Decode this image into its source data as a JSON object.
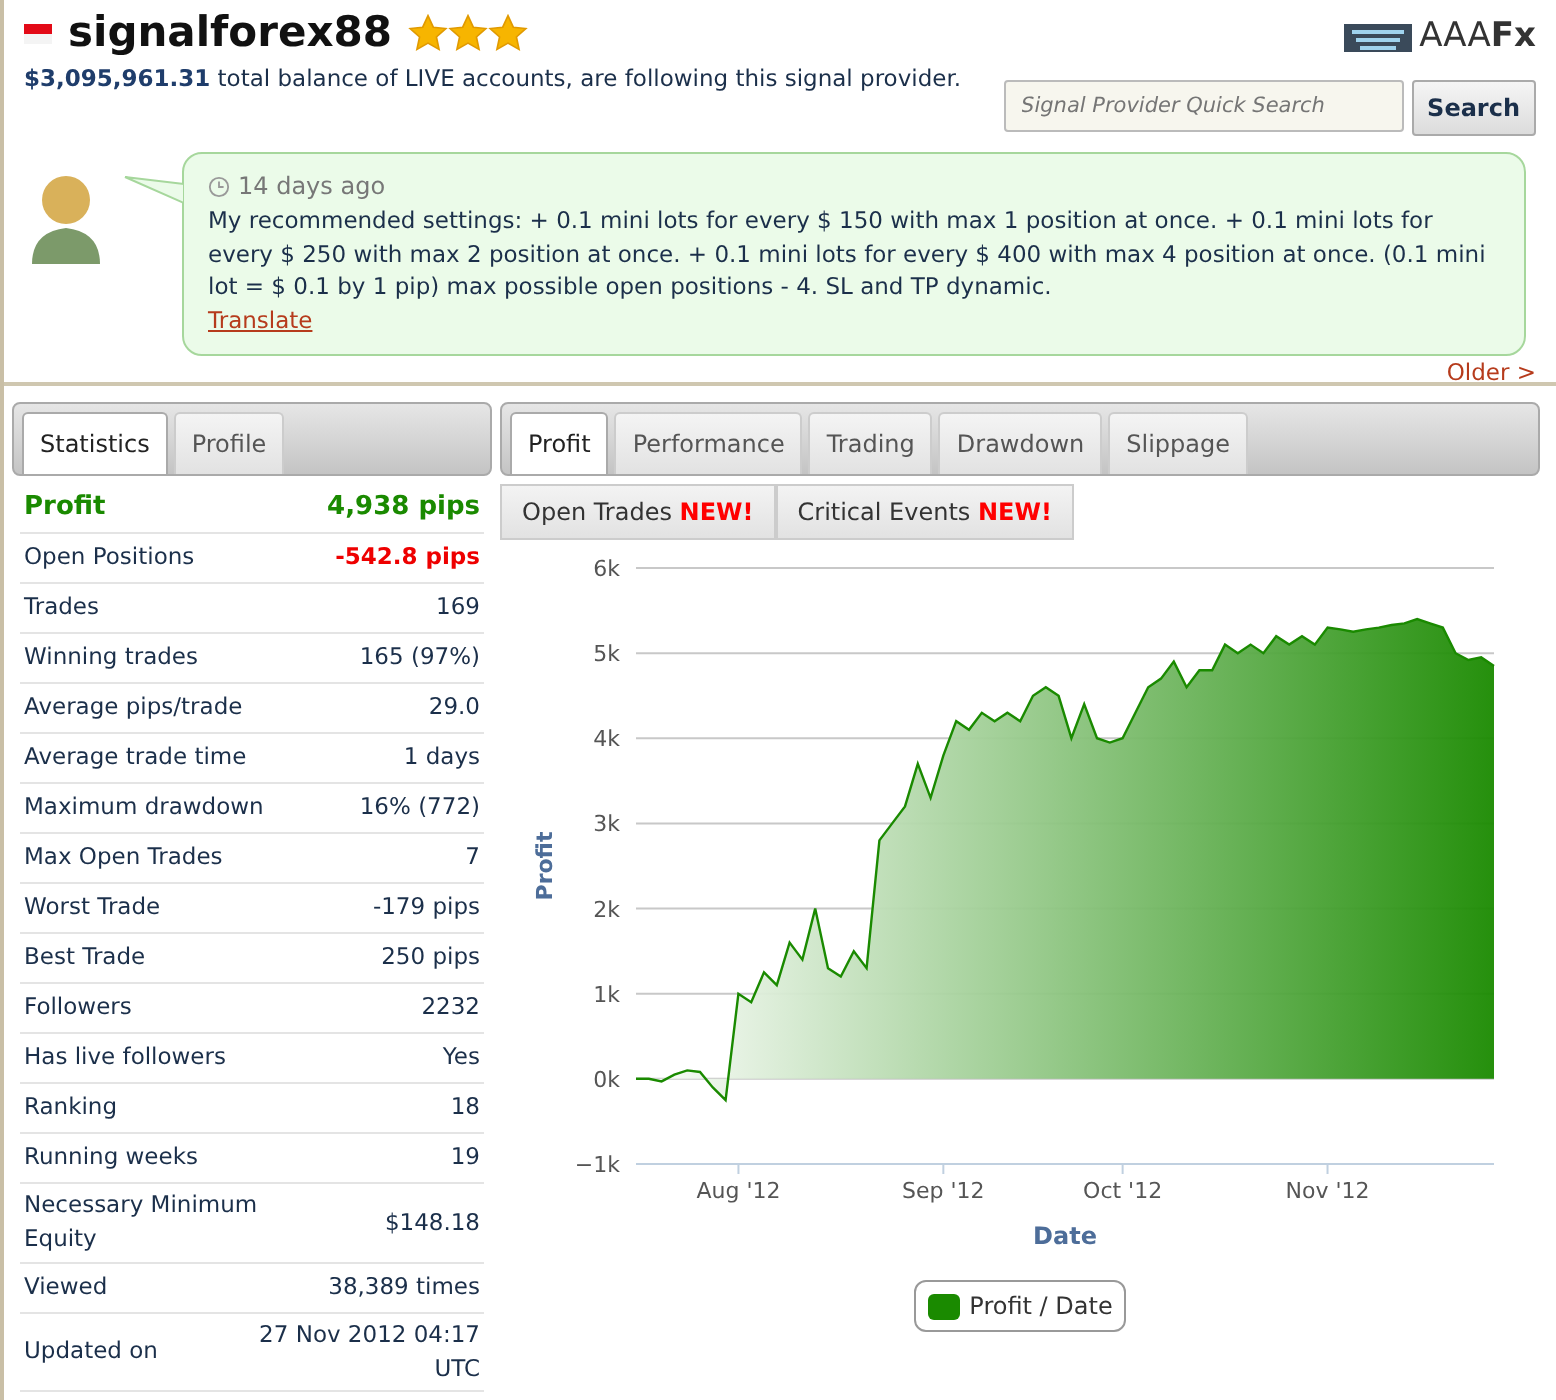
{
  "header": {
    "title": "signalforex88",
    "stars": 3,
    "balance": "$3,095,961.31",
    "balance_text": "total balance of LIVE accounts, are following this signal provider.",
    "logo": "AAA**Fx**",
    "search": {
      "placeholder": "Signal Provider Quick Search",
      "button": "Search"
    }
  },
  "message": {
    "time": "14 days ago",
    "text": "My recommended settings: + 0.1 mini lots for every $ 150 with max 1 position at once. + 0.1 mini lots for every $ 250 with max 2 position at once. + 0.1 mini lots for every $ 400 with max 4 position at once. (0.1 mini lot = $ 0.1 by 1 pip) max possible open positions - 4. SL and TP dynamic.",
    "link": "Translate",
    "older": "Older >"
  },
  "left_tabs": [
    {
      "label": "Statistics",
      "selected": true
    },
    {
      "label": "Profile",
      "selected": false
    }
  ],
  "stats": [
    {
      "label": "Profit",
      "value": "4,938 pips",
      "kind": "profit"
    },
    {
      "label": "Open Positions",
      "value": "-542.8 pips",
      "kind": "loss"
    },
    {
      "label": "Trades",
      "value": "169",
      "kind": "plain"
    },
    {
      "label": "Winning trades",
      "value": "165 (97%)",
      "kind": "plain"
    },
    {
      "label": "Average pips/trade",
      "value": "29.0",
      "kind": "plain"
    },
    {
      "label": "Average trade time",
      "value": "1 days",
      "kind": "plain"
    },
    {
      "label": "Maximum drawdown",
      "value": "16% (772)",
      "kind": "plain"
    },
    {
      "label": "Max Open Trades",
      "value": "7",
      "kind": "plain"
    },
    {
      "label": "Worst Trade",
      "value": "-179 pips",
      "kind": "plain"
    },
    {
      "label": "Best Trade",
      "value": "250 pips",
      "kind": "plain"
    },
    {
      "label": "Followers",
      "value": "2232",
      "kind": "plain"
    },
    {
      "label": "Has live followers",
      "value": "Yes",
      "kind": "plain"
    },
    {
      "label": "Ranking",
      "value": "18",
      "kind": "plain"
    },
    {
      "label": "Running weeks",
      "value": "19",
      "kind": "plain"
    },
    {
      "label": "Necessary Minimum Equity",
      "value": "$148.18",
      "kind": "plain"
    },
    {
      "label": "Viewed",
      "value": "38,389 times",
      "kind": "plain"
    },
    {
      "label": "Updated on",
      "value": "27 Nov 2012 04:17 UTC",
      "kind": "plain"
    }
  ],
  "right_tabs": [
    {
      "label": "Profit",
      "selected": true
    },
    {
      "label": "Performance",
      "selected": false
    },
    {
      "label": "Trading",
      "selected": false
    },
    {
      "label": "Drawdown",
      "selected": false
    },
    {
      "label": "Slippage",
      "selected": false
    }
  ],
  "sub_buttons": [
    "Open Trades **NEW!**",
    "Critical Events **NEW!**"
  ],
  "chart": {
    "chart_data": {
      "type": "area",
      "xlabel": "Date",
      "ylabel": "Profit",
      "categories": [
        null,
        null,
        null,
        null,
        null,
        null,
        null,
        null,
        "Aug '12",
        null,
        null,
        null,
        null,
        null,
        null,
        null,
        null,
        null,
        null,
        null,
        null,
        null,
        null,
        null,
        "Sep '12",
        null,
        null,
        null,
        null,
        null,
        null,
        null,
        null,
        null,
        null,
        null,
        null,
        null,
        "Oct '12",
        null,
        null,
        null,
        null,
        null,
        null,
        null,
        null,
        null,
        null,
        null,
        null,
        null,
        null,
        null,
        "Nov '12",
        null,
        null,
        null,
        null,
        null,
        null,
        null,
        null,
        null,
        null,
        null,
        null,
        null
      ],
      "series": [
        {
          "name": "Profit / Date",
          "color": "#1a8a00",
          "values": [
            0,
            0,
            -0.03,
            0.05,
            0.1,
            0.08,
            -0.1,
            -0.25,
            1.0,
            0.9,
            1.25,
            1.1,
            1.6,
            1.4,
            2.0,
            1.3,
            1.2,
            1.5,
            1.3,
            2.8,
            3.0,
            3.2,
            3.7,
            3.3,
            3.8,
            4.2,
            4.1,
            4.3,
            4.2,
            4.3,
            4.2,
            4.5,
            4.6,
            4.5,
            4.0,
            4.4,
            4.0,
            3.95,
            4.0,
            4.3,
            4.6,
            4.7,
            4.9,
            4.6,
            4.8,
            4.8,
            5.1,
            5.0,
            5.1,
            5.0,
            5.2,
            5.1,
            5.2,
            5.1,
            5.3,
            5.28,
            5.25,
            5.28,
            5.3,
            5.33,
            5.35,
            5.4,
            5.35,
            5.3,
            5.0,
            4.92,
            4.95,
            4.85
          ]
        }
      ],
      "grid": true,
      "ylim": [
        -1,
        6
      ],
      "yticks": [
        {
          "value": -1,
          "label": "−1k"
        },
        {
          "value": 0,
          "label": "0k"
        },
        {
          "value": 1,
          "label": "1k"
        },
        {
          "value": 2,
          "label": "2k"
        },
        {
          "value": 3,
          "label": "3k"
        },
        {
          "value": 4,
          "label": "4k"
        },
        {
          "value": 5,
          "label": "5k"
        },
        {
          "value": 6,
          "label": "6k"
        }
      ]
    }
  }
}
